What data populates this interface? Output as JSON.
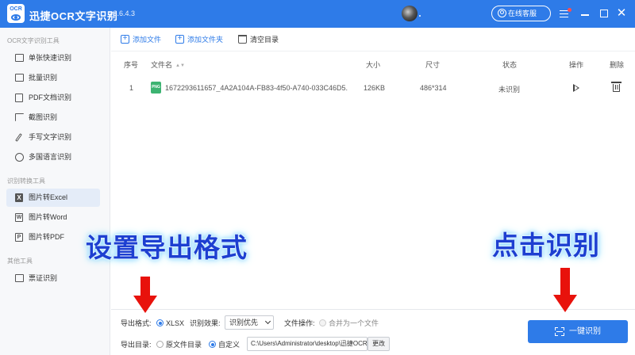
{
  "titlebar": {
    "app_title": "迅捷OCR文字识别",
    "version": "v8.6.4.3",
    "logo_text": "OCR",
    "service_label": "在线客服",
    "close_glyph": "✕"
  },
  "sidebar": {
    "sections": [
      {
        "label": "OCR文字识别工具",
        "items": [
          {
            "label": "单张快速识别",
            "icon": "image-icon"
          },
          {
            "label": "批量识别",
            "icon": "stack-icon"
          },
          {
            "label": "PDF文档识别",
            "icon": "pdf-document-icon"
          },
          {
            "label": "截图识别",
            "icon": "crop-icon"
          },
          {
            "label": "手写文字识别",
            "icon": "pen-icon"
          },
          {
            "label": "多国语言识别",
            "icon": "globe-icon"
          }
        ]
      },
      {
        "label": "识别转换工具",
        "items": [
          {
            "label": "图片转Excel",
            "icon": "excel-icon",
            "active": true
          },
          {
            "label": "图片转Word",
            "icon": "word-icon"
          },
          {
            "label": "图片转PDF",
            "icon": "pdf-icon"
          }
        ]
      },
      {
        "label": "其他工具",
        "items": [
          {
            "label": "票证识别",
            "icon": "ticket-icon"
          }
        ]
      }
    ]
  },
  "toolbar": {
    "add_file": "添加文件",
    "add_folder": "添加文件夹",
    "clear": "清空目录"
  },
  "table": {
    "headers": {
      "index": "序号",
      "filename": "文件名",
      "size": "大小",
      "dimensions": "尺寸",
      "status": "状态",
      "action": "操作",
      "delete": "删除"
    },
    "rows": [
      {
        "index": "1",
        "file_type": "PNG",
        "filename": "1672293611657_4A2A104A-FB83-4f50-A740-033C46D5...",
        "size": "126KB",
        "dimensions": "486*314",
        "status": "未识别"
      }
    ]
  },
  "bottom": {
    "format_label": "导出格式:",
    "format_value": "XLSX",
    "effect_label": "识别效果:",
    "effect_value": "识别优先",
    "file_op_label": "文件操作:",
    "merge_label": "合并为一个文件",
    "dir_label": "导出目录:",
    "dir_original": "原文件目录",
    "dir_custom": "自定义",
    "path_value": "C:\\Users\\Administrator\\desktop\\迅捷OCR文字识别",
    "change_button": "更改",
    "recognize_button": "一键识别"
  },
  "annotations": {
    "left_text": "设置导出格式",
    "right_text": "点击识别",
    "arrow_color": "#e8120c",
    "text_color": "#1d3fd1"
  },
  "colors": {
    "accent": "#2e7be8"
  }
}
